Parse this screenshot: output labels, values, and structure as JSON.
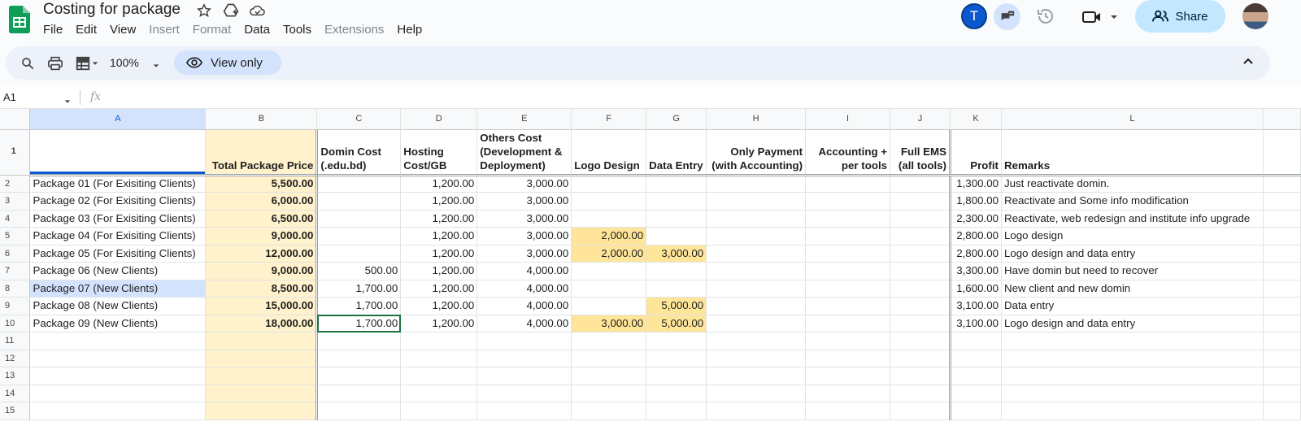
{
  "app": {
    "title": "Costing for package",
    "menu": [
      "File",
      "Edit",
      "View",
      "Insert",
      "Format",
      "Data",
      "Tools",
      "Extensions",
      "Help"
    ],
    "menu_dimmed": [
      "Insert",
      "Format",
      "Extensions"
    ],
    "avatar_initial": "T",
    "share_label": "Share"
  },
  "toolbar": {
    "zoom": "100%",
    "view_only_label": "View only"
  },
  "formula_bar": {
    "name_box": "A1",
    "fx": "fx"
  },
  "sheet": {
    "columns": [
      "A",
      "B",
      "C",
      "D",
      "E",
      "F",
      "G",
      "H",
      "I",
      "J",
      "K",
      "L"
    ],
    "header_row": [
      "",
      "Total Package Price",
      "Domin Cost (.edu.bd)",
      "Hosting Cost/GB",
      "Others Cost (Development & Deployment)",
      "Logo Design",
      "Data Entry",
      "Only Payment (with Accounting)",
      "Accounting + per tools",
      "Full EMS (all tools)",
      "Profit",
      "Remarks"
    ],
    "rows": [
      [
        "Package 01 (For Exisiting Clients)",
        "5,500.00",
        "",
        "1,200.00",
        "3,000.00",
        "",
        "",
        "",
        "",
        "",
        "1,300.00",
        "Just reactivate domin."
      ],
      [
        "Package 02 (For Exisiting Clients)",
        "6,000.00",
        "",
        "1,200.00",
        "3,000.00",
        "",
        "",
        "",
        "",
        "",
        "1,800.00",
        "Reactivate and Some info modification"
      ],
      [
        "Package 03 (For Exisiting Clients)",
        "6,500.00",
        "",
        "1,200.00",
        "3,000.00",
        "",
        "",
        "",
        "",
        "",
        "2,300.00",
        "Reactivate, web redesign and institute info upgrade"
      ],
      [
        "Package 04 (For Exisiting Clients)",
        "9,000.00",
        "",
        "1,200.00",
        "3,000.00",
        "2,000.00",
        "",
        "",
        "",
        "",
        "2,800.00",
        "Logo design"
      ],
      [
        "Package 05 (For Exisiting Clients)",
        "12,000.00",
        "",
        "1,200.00",
        "3,000.00",
        "2,000.00",
        "3,000.00",
        "",
        "",
        "",
        "2,800.00",
        "Logo design and data entry"
      ],
      [
        "Package 06 (New Clients)",
        "9,000.00",
        "500.00",
        "1,200.00",
        "4,000.00",
        "",
        "",
        "",
        "",
        "",
        "3,300.00",
        "Have domin but need to recover"
      ],
      [
        "Package 07 (New Clients)",
        "8,500.00",
        "1,700.00",
        "1,200.00",
        "4,000.00",
        "",
        "",
        "",
        "",
        "",
        "1,600.00",
        "New client and new domin"
      ],
      [
        "Package 08 (New Clients)",
        "15,000.00",
        "1,700.00",
        "1,200.00",
        "4,000.00",
        "",
        "5,000.00",
        "",
        "",
        "",
        "3,100.00",
        "Data entry"
      ],
      [
        "Package 09 (New Clients)",
        "18,000.00",
        "1,700.00",
        "1,200.00",
        "4,000.00",
        "3,000.00",
        "5,000.00",
        "",
        "",
        "",
        "3,100.00",
        "Logo design and data entry"
      ]
    ],
    "row_numbers": [
      "1",
      "2",
      "3",
      "4",
      "5",
      "6",
      "7",
      "8",
      "9",
      "10",
      "11",
      "12",
      "13",
      "14",
      "15"
    ],
    "colors": {
      "price_fill": "#fff2cc",
      "extra_cost_fill": "#ffe599",
      "selection": "#d3e3fd",
      "active_border": "#1a7340"
    }
  }
}
